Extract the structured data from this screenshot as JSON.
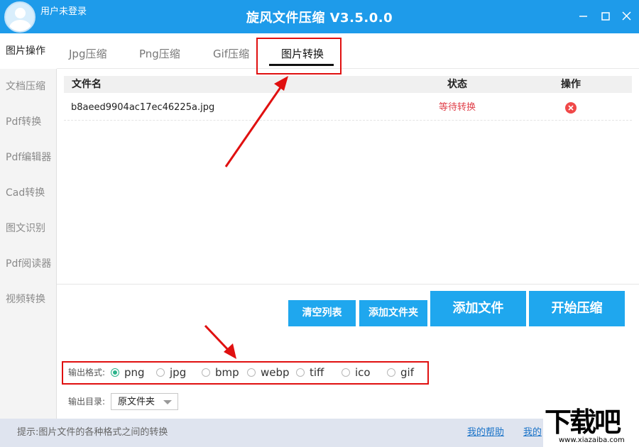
{
  "titlebar": {
    "user_label": "用户未登录",
    "app_title": "旋风文件压缩 V3.5.0.0"
  },
  "sidebar": {
    "items": [
      {
        "label": "图片操作",
        "active": true
      },
      {
        "label": "文档压缩"
      },
      {
        "label": "Pdf转换"
      },
      {
        "label": "Pdf编辑器"
      },
      {
        "label": "Cad转换"
      },
      {
        "label": "图文识别"
      },
      {
        "label": "Pdf阅读器"
      },
      {
        "label": "视频转换"
      }
    ]
  },
  "tabs": [
    {
      "label": "Jpg压缩"
    },
    {
      "label": "Png压缩"
    },
    {
      "label": "Gif压缩"
    },
    {
      "label": "图片转换",
      "active": true
    }
  ],
  "table": {
    "headers": {
      "name": "文件名",
      "status": "状态",
      "action": "操作"
    },
    "rows": [
      {
        "name": "b8aeed9904ac17ec46225a.jpg",
        "status": "等待转换"
      }
    ]
  },
  "actions": {
    "clear": "清空列表",
    "add_folder": "添加文件夹",
    "add_file": "添加文件",
    "start": "开始压缩"
  },
  "output_format": {
    "label": "输出格式:",
    "options": [
      "png",
      "jpg",
      "bmp",
      "webp",
      "tiff",
      "ico",
      "gif"
    ],
    "selected": "png"
  },
  "output_dir": {
    "label": "输出目录:",
    "value": "原文件夹"
  },
  "statusbar": {
    "hint": "提示:图片文件的各种格式之间的转换",
    "help_link": "我的帮助",
    "mine_link": "我的"
  },
  "watermark": {
    "big": "下载吧",
    "small": "www.xiazaiba.com"
  },
  "colors": {
    "titlebar": "#1e9bea",
    "button": "#1fa7ee",
    "annotation": "#e01010",
    "status_text": "#e0404a",
    "radio_checked": "#2ab38a"
  }
}
